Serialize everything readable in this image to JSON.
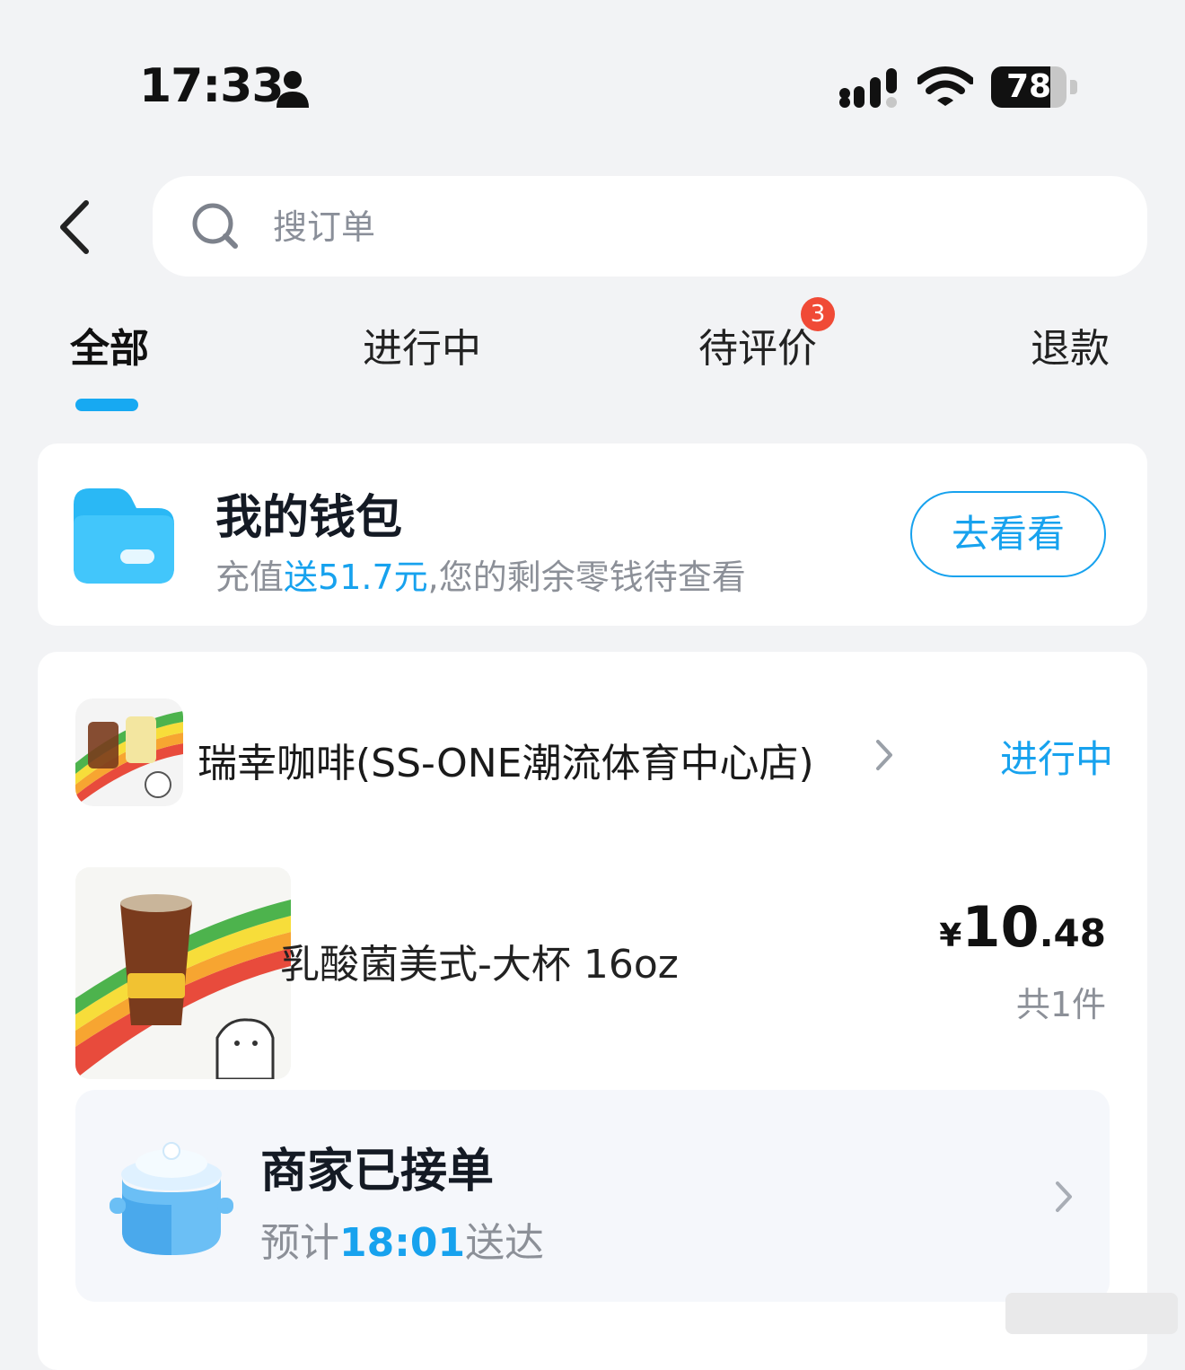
{
  "status_bar": {
    "time": "17:33",
    "battery": "78",
    "battery_level": 0.78,
    "icons": [
      "person-icon",
      "signal-icon",
      "wifi-icon",
      "battery-icon"
    ]
  },
  "header": {
    "back_icon": "chevron-left-icon",
    "search": {
      "placeholder": "搜订单",
      "value": ""
    }
  },
  "tabs": [
    {
      "label": "全部",
      "active": true
    },
    {
      "label": "进行中"
    },
    {
      "label": "待评价",
      "badge": "3"
    },
    {
      "label": "退款"
    }
  ],
  "wallet": {
    "title": "我的钱包",
    "subtitle_prefix": "充值",
    "subtitle_highlight": "送51.7元",
    "subtitle_suffix": ",您的剩余零钱待查看",
    "button": "去看看",
    "icon": "wallet-folder-icon"
  },
  "order": {
    "store_name": "瑞幸咖啡(SS-ONE潮流体育中心店)",
    "status": "进行中",
    "product": {
      "name": "乳酸菌美式-大杯 16oz",
      "price_symbol": "¥",
      "price_int": "10",
      "price_dec": ".48",
      "quantity": "共1件"
    },
    "delivery": {
      "title": "商家已接单",
      "eta_prefix": "预计",
      "eta_time": "18:01",
      "eta_suffix": "送达",
      "icon": "pot-icon"
    }
  },
  "colors": {
    "accent": "#17a2ee",
    "badge": "#f04a36",
    "background": "#f2f3f5"
  }
}
